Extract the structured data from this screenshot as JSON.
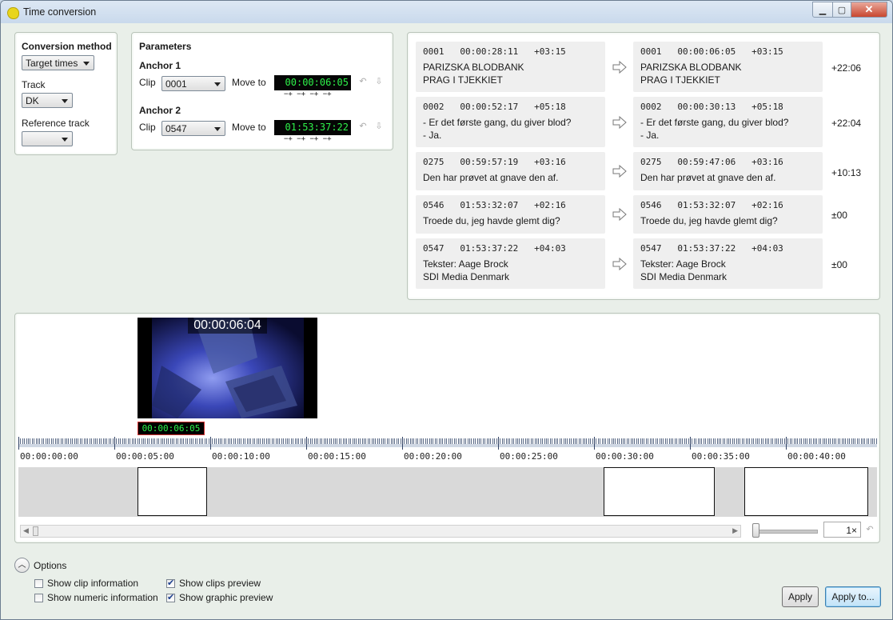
{
  "window": {
    "title": "Time conversion"
  },
  "conversion": {
    "title": "Conversion method",
    "method": "Target times",
    "track_label": "Track",
    "track": "DK",
    "reference_label": "Reference track",
    "reference": ""
  },
  "parameters": {
    "title": "Parameters",
    "anchor1": {
      "title": "Anchor 1",
      "clip_label": "Clip",
      "clip": "0001",
      "move_label": "Move to",
      "tc": "00:00:06:05"
    },
    "anchor2": {
      "title": "Anchor 2",
      "clip_label": "Clip",
      "clip": "0547",
      "move_label": "Move to",
      "tc": "01:53:37:22"
    },
    "steps": "−+ −+ −+ −+"
  },
  "mappings": [
    {
      "src_hdr": "0001   00:00:28:11   +03:15",
      "src_l1": "PARIZSKA BLODBANK",
      "src_l2": "PRAG I TJEKKIET",
      "dst_hdr": "0001   00:00:06:05   +03:15",
      "dst_l1": "PARIZSKA BLODBANK",
      "dst_l2": "PRAG I TJEKKIET",
      "delta": "+22:06"
    },
    {
      "src_hdr": "0002   00:00:52:17   +05:18",
      "src_l1": "- Er det første gang, du giver blod?",
      "src_l2": "- Ja.",
      "dst_hdr": "0002   00:00:30:13   +05:18",
      "dst_l1": "- Er det første gang, du giver blod?",
      "dst_l2": "- Ja.",
      "delta": "+22:04"
    },
    {
      "src_hdr": "0275   00:59:57:19   +03:16",
      "src_l1": "Den har prøvet at gnave den af.",
      "src_l2": "",
      "dst_hdr": "0275   00:59:47:06   +03:16",
      "dst_l1": "Den har prøvet at gnave den af.",
      "dst_l2": "",
      "delta": "+10:13"
    },
    {
      "src_hdr": "0546   01:53:32:07   +02:16",
      "src_l1": "Troede du, jeg havde glemt dig?",
      "src_l2": "",
      "dst_hdr": "0546   01:53:32:07   +02:16",
      "dst_l1": "Troede du, jeg havde glemt dig?",
      "dst_l2": "",
      "delta": "±00"
    },
    {
      "src_hdr": "0547   01:53:37:22   +04:03",
      "src_l1": "Tekster: Aage Brock",
      "src_l2": "SDI Media Denmark",
      "dst_hdr": "0547   01:53:37:22   +04:03",
      "dst_l1": "Tekster: Aage Brock",
      "dst_l2": "SDI Media Denmark",
      "delta": "±00"
    }
  ],
  "preview": {
    "timecode": "00:00:06:04",
    "cursor_tc": "00:00:06:05"
  },
  "ruler": [
    "00:00:00:00",
    "00:00:05:00",
    "00:00:10:00",
    "00:00:15:00",
    "00:00:20:00",
    "00:00:25:00",
    "00:00:30:00",
    "00:00:35:00",
    "00:00:40:00"
  ],
  "zoom": "1×",
  "options": {
    "title": "Options",
    "clip_info": {
      "label": "Show clip information",
      "checked": false
    },
    "numeric_info": {
      "label": "Show numeric information",
      "checked": false
    },
    "clips_preview": {
      "label": "Show clips preview",
      "checked": true
    },
    "graphic_preview": {
      "label": "Show graphic preview",
      "checked": true
    }
  },
  "buttons": {
    "apply": "Apply",
    "apply_to": "Apply to..."
  }
}
